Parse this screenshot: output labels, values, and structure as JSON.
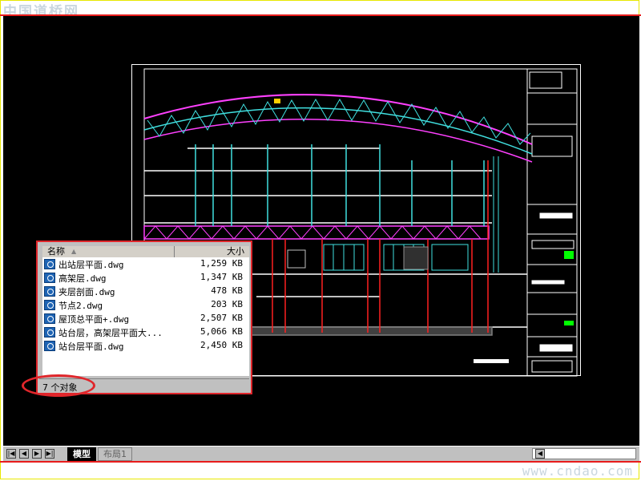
{
  "watermarks": {
    "top": "中国道桥网",
    "bottom": "www.cndao.com"
  },
  "explorer": {
    "columns": {
      "name": "名称",
      "size": "大小"
    },
    "files": [
      {
        "name": "出站层平面.dwg",
        "size": "1,259 KB"
      },
      {
        "name": "高架层.dwg",
        "size": "1,347 KB"
      },
      {
        "name": "夹层剖面.dwg",
        "size": "478 KB"
      },
      {
        "name": "节点2.dwg",
        "size": "203 KB"
      },
      {
        "name": "屋顶总平面+.dwg",
        "size": "2,507 KB"
      },
      {
        "name": "站台层，高架层平面大...",
        "size": "5,066 KB"
      },
      {
        "name": "站台层平面.dwg",
        "size": "2,450 KB"
      }
    ],
    "status": "7 个对象",
    "file_icon": "dwg-file-icon",
    "sort_icon": "sort-ascending-icon"
  },
  "tabs": [
    {
      "label": "模型",
      "active": true
    },
    {
      "label": "布局1",
      "active": false
    }
  ],
  "nav_buttons": [
    "first-tab",
    "previous-tab",
    "next-tab",
    "last-tab"
  ],
  "colors": {
    "accent_red": "#e0262b",
    "canvas": "#000000",
    "magenta": "#ff40ff",
    "cyan": "#40e0e0"
  }
}
